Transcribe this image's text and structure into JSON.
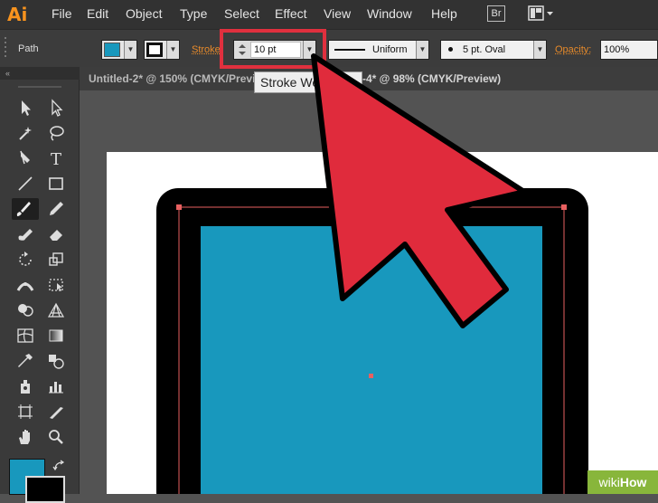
{
  "app": {
    "logo": "Ai"
  },
  "menubar": {
    "items": [
      "File",
      "Edit",
      "Object",
      "Type",
      "Select",
      "Effect",
      "View",
      "Window",
      "Help"
    ],
    "bridge_label": "Br"
  },
  "control_bar": {
    "selection_label": "Path",
    "stroke_label": "Stroke",
    "stroke_weight": "10 pt",
    "profile_value": "Uniform",
    "brush_value": "5 pt. Oval",
    "opacity_label": "Opacity:",
    "opacity_value": "100%"
  },
  "tabs": [
    {
      "label": "Untitled-2* @ 150% (CMYK/Preview)"
    },
    {
      "label": "-4* @ 98% (CMYK/Preview)"
    }
  ],
  "tooltip": {
    "text": "Stroke Weight"
  },
  "tools_panel": {
    "collapse_glyph": "«",
    "tools": [
      "selection",
      "direct-selection",
      "magic-wand",
      "lasso",
      "pen",
      "type",
      "line-segment",
      "rectangle",
      "paintbrush",
      "pencil",
      "blob-brush",
      "eraser",
      "rotate",
      "scale",
      "width",
      "free-transform",
      "shape-builder",
      "perspective-grid",
      "mesh",
      "gradient",
      "eyedropper",
      "blend",
      "symbol-sprayer",
      "column-graph",
      "artboard",
      "slice",
      "hand",
      "zoom"
    ]
  },
  "colors": {
    "fill": "#1898bd",
    "stroke": "#000000",
    "highlight_box": "#e0303e",
    "arrow": "#e02b3c",
    "selection_path": "#e86060"
  },
  "watermark": {
    "prefix": "wiki",
    "suffix": "How"
  }
}
